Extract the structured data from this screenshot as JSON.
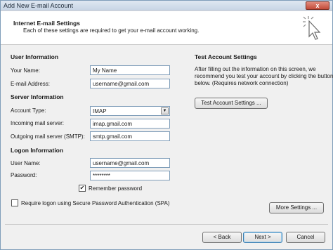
{
  "window": {
    "title": "Add New E-mail Account",
    "close_label": "x"
  },
  "header": {
    "title": "Internet E-mail Settings",
    "subtitle": "Each of these settings are required to get your e-mail account working."
  },
  "user_info": {
    "section_title": "User Information",
    "name_label": "Your Name:",
    "name_value": "My Name",
    "email_label": "E-mail Address:",
    "email_value": "username@gmail.com"
  },
  "server_info": {
    "section_title": "Server Information",
    "account_type_label": "Account Type:",
    "account_type_value": "IMAP",
    "incoming_label": "Incoming mail server:",
    "incoming_value": "imap.gmail.com",
    "outgoing_label": "Outgoing mail server (SMTP):",
    "outgoing_value": "smtp.gmail.com"
  },
  "logon_info": {
    "section_title": "Logon Information",
    "username_label": "User Name:",
    "username_value": "username@gmail.com",
    "password_label": "Password:",
    "password_value": "********",
    "remember_label": "Remember password",
    "remember_checked": true,
    "spa_label": "Require logon using Secure Password Authentication (SPA)",
    "spa_checked": false
  },
  "test": {
    "section_title": "Test Account Settings",
    "description": "After filling out the information on this screen, we recommend you test your account by clicking the button below. (Requires network connection)",
    "button_label": "Test Account Settings ..."
  },
  "buttons": {
    "more_settings": "More Settings ...",
    "back": "< Back",
    "next": "Next >",
    "cancel": "Cancel"
  },
  "icons": {
    "checkmark": "✔",
    "dropdown_arrow": "▼"
  }
}
